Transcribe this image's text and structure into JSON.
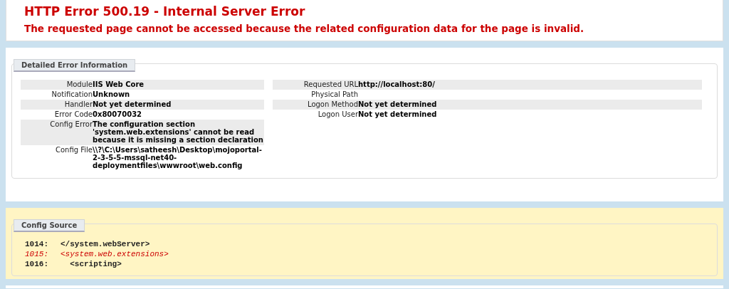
{
  "header": {
    "title": "HTTP Error 500.19 - Internal Server Error",
    "subtitle": "The requested page cannot be accessed because the related configuration data for the page is invalid."
  },
  "detailed_error": {
    "legend": "Detailed Error Information",
    "left_rows": [
      {
        "label": "Module",
        "value": "IIS Web Core"
      },
      {
        "label": "Notification",
        "value": "Unknown"
      },
      {
        "label": "Handler",
        "value": "Not yet determined"
      },
      {
        "label": "Error Code",
        "value": "0x80070032"
      },
      {
        "label": "Config Error",
        "value": "The configuration section 'system.web.extensions' cannot be read because it is missing a section declaration"
      },
      {
        "label": "Config File",
        "value": "\\\\?\\C:\\Users\\satheesh\\Desktop\\mojoportal-2-3-5-5-mssql-net40-deploymentfiles\\wwwroot\\web.config"
      }
    ],
    "right_rows": [
      {
        "label": "Requested URL",
        "value": "http://localhost:80/"
      },
      {
        "label": "Physical Path"
      },
      {
        "label": "Logon Method",
        "value": "Not yet determined"
      },
      {
        "label": "Logon User",
        "value": "Not yet determined"
      }
    ]
  },
  "config_source": {
    "legend": "Config Source",
    "lines": [
      {
        "number": "1014:",
        "code": "</system.webServer>",
        "highlighted": false
      },
      {
        "number": "1015:",
        "code": "<system.web.extensions>",
        "highlighted": true
      },
      {
        "number": "1016:",
        "code": "  <scripting>",
        "highlighted": false
      }
    ]
  }
}
